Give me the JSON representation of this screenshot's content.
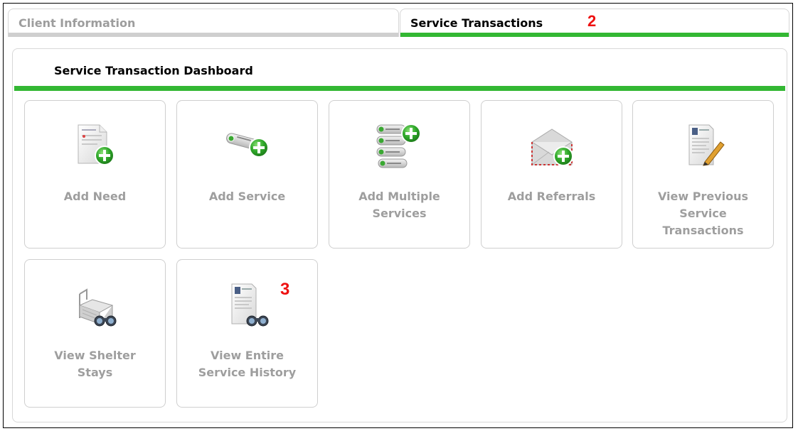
{
  "tabs": {
    "client_information": "Client Information",
    "service_transactions": "Service Transactions",
    "service_marker": "2"
  },
  "dashboard": {
    "title": "Service Transaction Dashboard",
    "tiles": [
      {
        "label": "Add Need",
        "icon": "add-need-icon"
      },
      {
        "label": "Add Service",
        "icon": "add-service-icon"
      },
      {
        "label": "Add Multiple\nServices",
        "icon": "add-multiple-services-icon"
      },
      {
        "label": "Add Referrals",
        "icon": "add-referrals-icon"
      },
      {
        "label": "View Previous\nService\nTransactions",
        "icon": "view-previous-transactions-icon"
      },
      {
        "label": "View Shelter\nStays",
        "icon": "view-shelter-stays-icon"
      },
      {
        "label": "View Entire\nService History",
        "icon": "view-service-history-icon"
      }
    ],
    "history_marker": "3"
  },
  "colors": {
    "accent_green": "#33b733",
    "marker_red": "#ee1111",
    "muted_text": "#9e9e9e"
  }
}
